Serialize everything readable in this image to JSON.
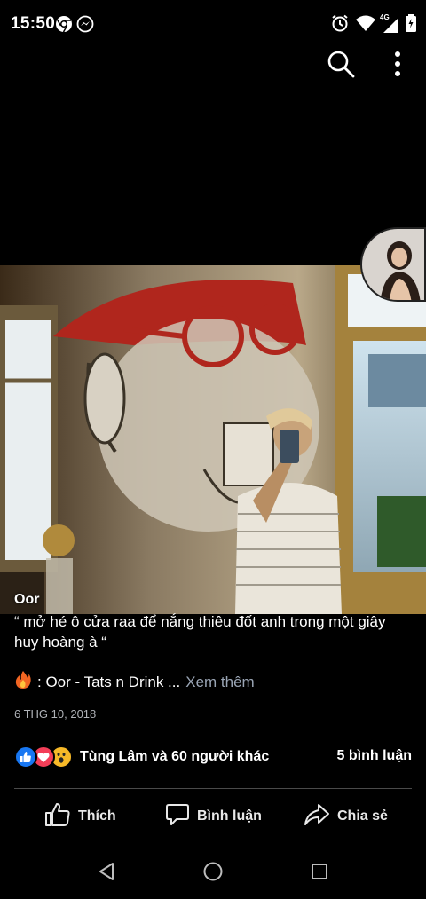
{
  "status_bar": {
    "time": "15:50",
    "left_icons": [
      "chrome-icon",
      "messenger-icon"
    ],
    "right_icons": [
      "alarm-icon",
      "wifi-icon",
      "signal-icon",
      "battery-icon"
    ],
    "network": "4G"
  },
  "top_bar": {
    "icons": [
      "search-icon",
      "more-vertical-icon"
    ]
  },
  "post": {
    "author": "Oor",
    "caption": "“ mở hé ô cửa raa để nắng thiêu đốt anh trong một giây huy hoàng à “",
    "song_line": ": Oor - Tats n Drink ...",
    "see_more": "Xem thêm",
    "date": "6 THG 10, 2018",
    "reaction_icons": [
      "like-icon",
      "love-icon",
      "wow-icon"
    ],
    "reactions_text": "Tùng Lâm và 60 người khác",
    "comments_count": "5 bình luận"
  },
  "actions": {
    "like": "Thích",
    "comment": "Bình luận",
    "share": "Chia sẻ"
  },
  "nav_bar": {
    "icons": [
      "back-icon",
      "home-icon",
      "recents-icon"
    ]
  },
  "colors": {
    "background": "#000000",
    "see_more": "#9aa5b5",
    "like_blue": "#1877f2",
    "love_red": "#f33e58",
    "wow_yellow": "#f7b928"
  }
}
